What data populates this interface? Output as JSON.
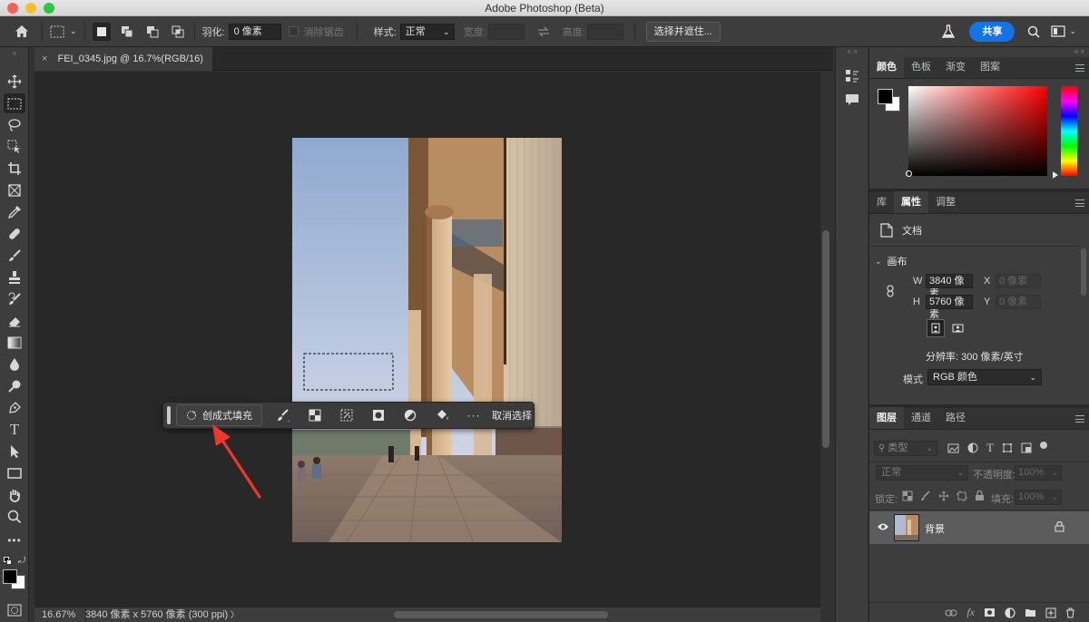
{
  "window": {
    "title": "Adobe Photoshop (Beta)"
  },
  "colors": {
    "accent": "#1473e6",
    "close": "#ff5f57",
    "minimize": "#febc2e",
    "zoom": "#28c840",
    "arrow": "#f0352c"
  },
  "options_bar": {
    "feather_label": "羽化:",
    "feather_value": "0 像素",
    "antialias_label": "消除锯齿",
    "style_label": "样式:",
    "style_value": "正常",
    "width_label": "宽度:",
    "height_label": "高度:",
    "select_mask_button": "选择并遮住...",
    "share_button": "共享"
  },
  "document_tab": {
    "title": "FEI_0345.jpg @ 16.7%(RGB/16)",
    "close": "×"
  },
  "contextual_bar": {
    "generative_fill": "创成式填充",
    "more": "···",
    "deselect": "取消选择"
  },
  "status_bar": {
    "zoom": "16.67%",
    "info": "3840 像素 x 5760 像素 (300 ppi)",
    "arrow": "〉"
  },
  "color_panel": {
    "tabs": [
      "颜色",
      "色板",
      "渐变",
      "图案"
    ]
  },
  "properties_panel": {
    "tabs": [
      "库",
      "属性",
      "调整"
    ],
    "doc_label": "文档",
    "canvas_section": "画布",
    "w_label": "W",
    "w_value": "3840 像素",
    "h_label": "H",
    "h_value": "5760 像素",
    "x_label": "X",
    "x_placeholder": "0 像素",
    "y_label": "Y",
    "y_placeholder": "0 像素",
    "resolution": "分辨率: 300 像素/英寸",
    "mode_label": "模式",
    "mode_value": "RGB 颜色"
  },
  "layers_panel": {
    "tabs": [
      "图层",
      "通道",
      "路径"
    ],
    "filter_label": "类型",
    "blend_mode": "正常",
    "opacity_label": "不透明度:",
    "opacity_value": "100%",
    "lock_label": "锁定:",
    "fill_label": "填充:",
    "fill_value": "100%",
    "layer_name": "背景"
  }
}
